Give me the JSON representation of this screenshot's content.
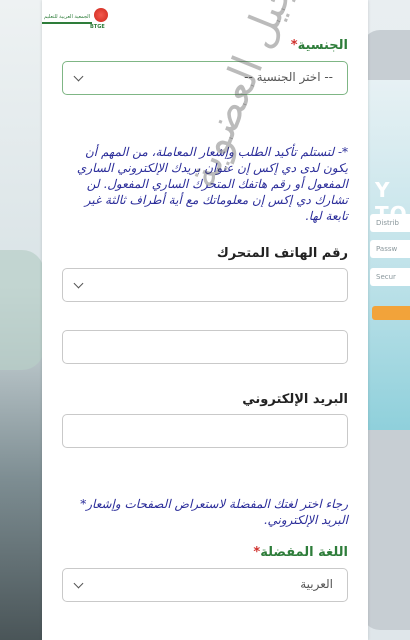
{
  "logo": {
    "line1": "الجمعية العربية للتعليم",
    "line2": "BTGE"
  },
  "nationality": {
    "label": "الجنسية",
    "required": "*",
    "placeholder": "-- اختر الجنسية --"
  },
  "phone_note": "*- لتستلم تأكيد الطلب وإشعار المعاملة، من المهم أن يكون لدى دي إكس إن عنوان بريدك الإلكتروني الساري المفعول أو رقم هاتفك المتحرك الساري المفعول. لن تشارك دي إكس إن معلوماتك مع أية أطراف ثالثة غير تابعة لها.",
  "phone": {
    "label": "رقم الهاتف المتحرك",
    "code_value": "",
    "number_value": ""
  },
  "email": {
    "label": "البريد الإلكتروني",
    "value": ""
  },
  "language_note": "رجاء اختر لغتك المفضلة لاستعراض الصفحات وإشعار* البريد الإلكتروني.",
  "language": {
    "label": "اللغة المفضلة",
    "required": "*",
    "value": "العربية"
  },
  "watermark": "صفحة تسجيل العضوية",
  "background": {
    "screen_text": "Y TO",
    "field1": "Distrib",
    "field2": "Passw",
    "field3": "Secur"
  },
  "colors": {
    "label_green": "#2e7d3a",
    "note_blue": "#2b2d9a",
    "required_red": "#d0312d"
  }
}
